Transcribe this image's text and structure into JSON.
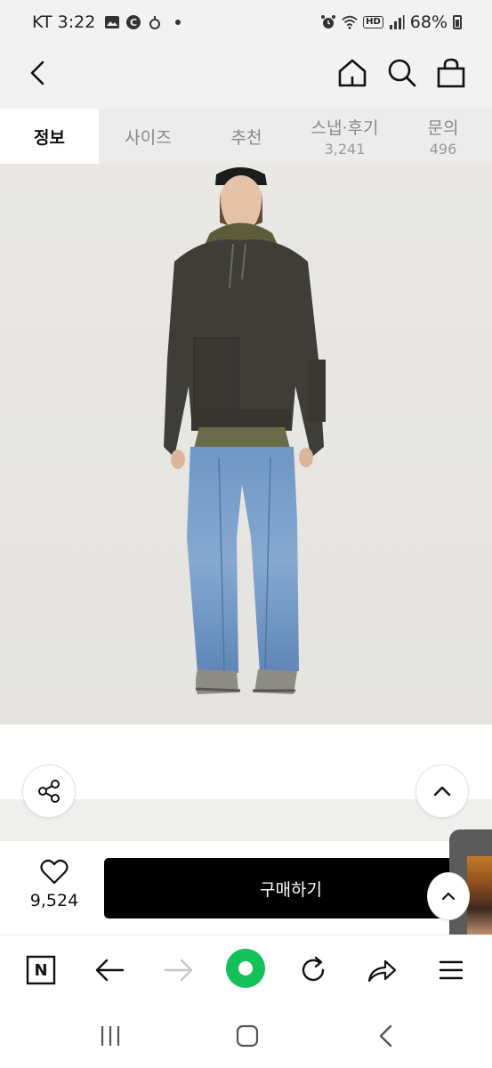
{
  "status_bar": {
    "carrier_time": "KT 3:22",
    "hd_badge": "HD",
    "battery_percent": "68%",
    "battery_level": 0.68
  },
  "app_bar": {
    "back_icon": "chevron-left-icon",
    "home_icon": "home-icon",
    "search_icon": "search-icon",
    "bag_icon": "shopping-bag-icon"
  },
  "tabs": [
    {
      "label": "정보",
      "count": ""
    },
    {
      "label": "사이즈",
      "count": ""
    },
    {
      "label": "추천",
      "count": ""
    },
    {
      "label": "스냅·후기",
      "count": "3,241"
    },
    {
      "label": "문의",
      "count": "496"
    }
  ],
  "purchase": {
    "like_count": "9,524",
    "buy_label": "구매하기"
  },
  "browser_toolbar": {
    "naver_label": "N"
  },
  "colors": {
    "accent_green": "#13c05a",
    "buy_button": "#000000",
    "tab_bg": "#ececec"
  }
}
